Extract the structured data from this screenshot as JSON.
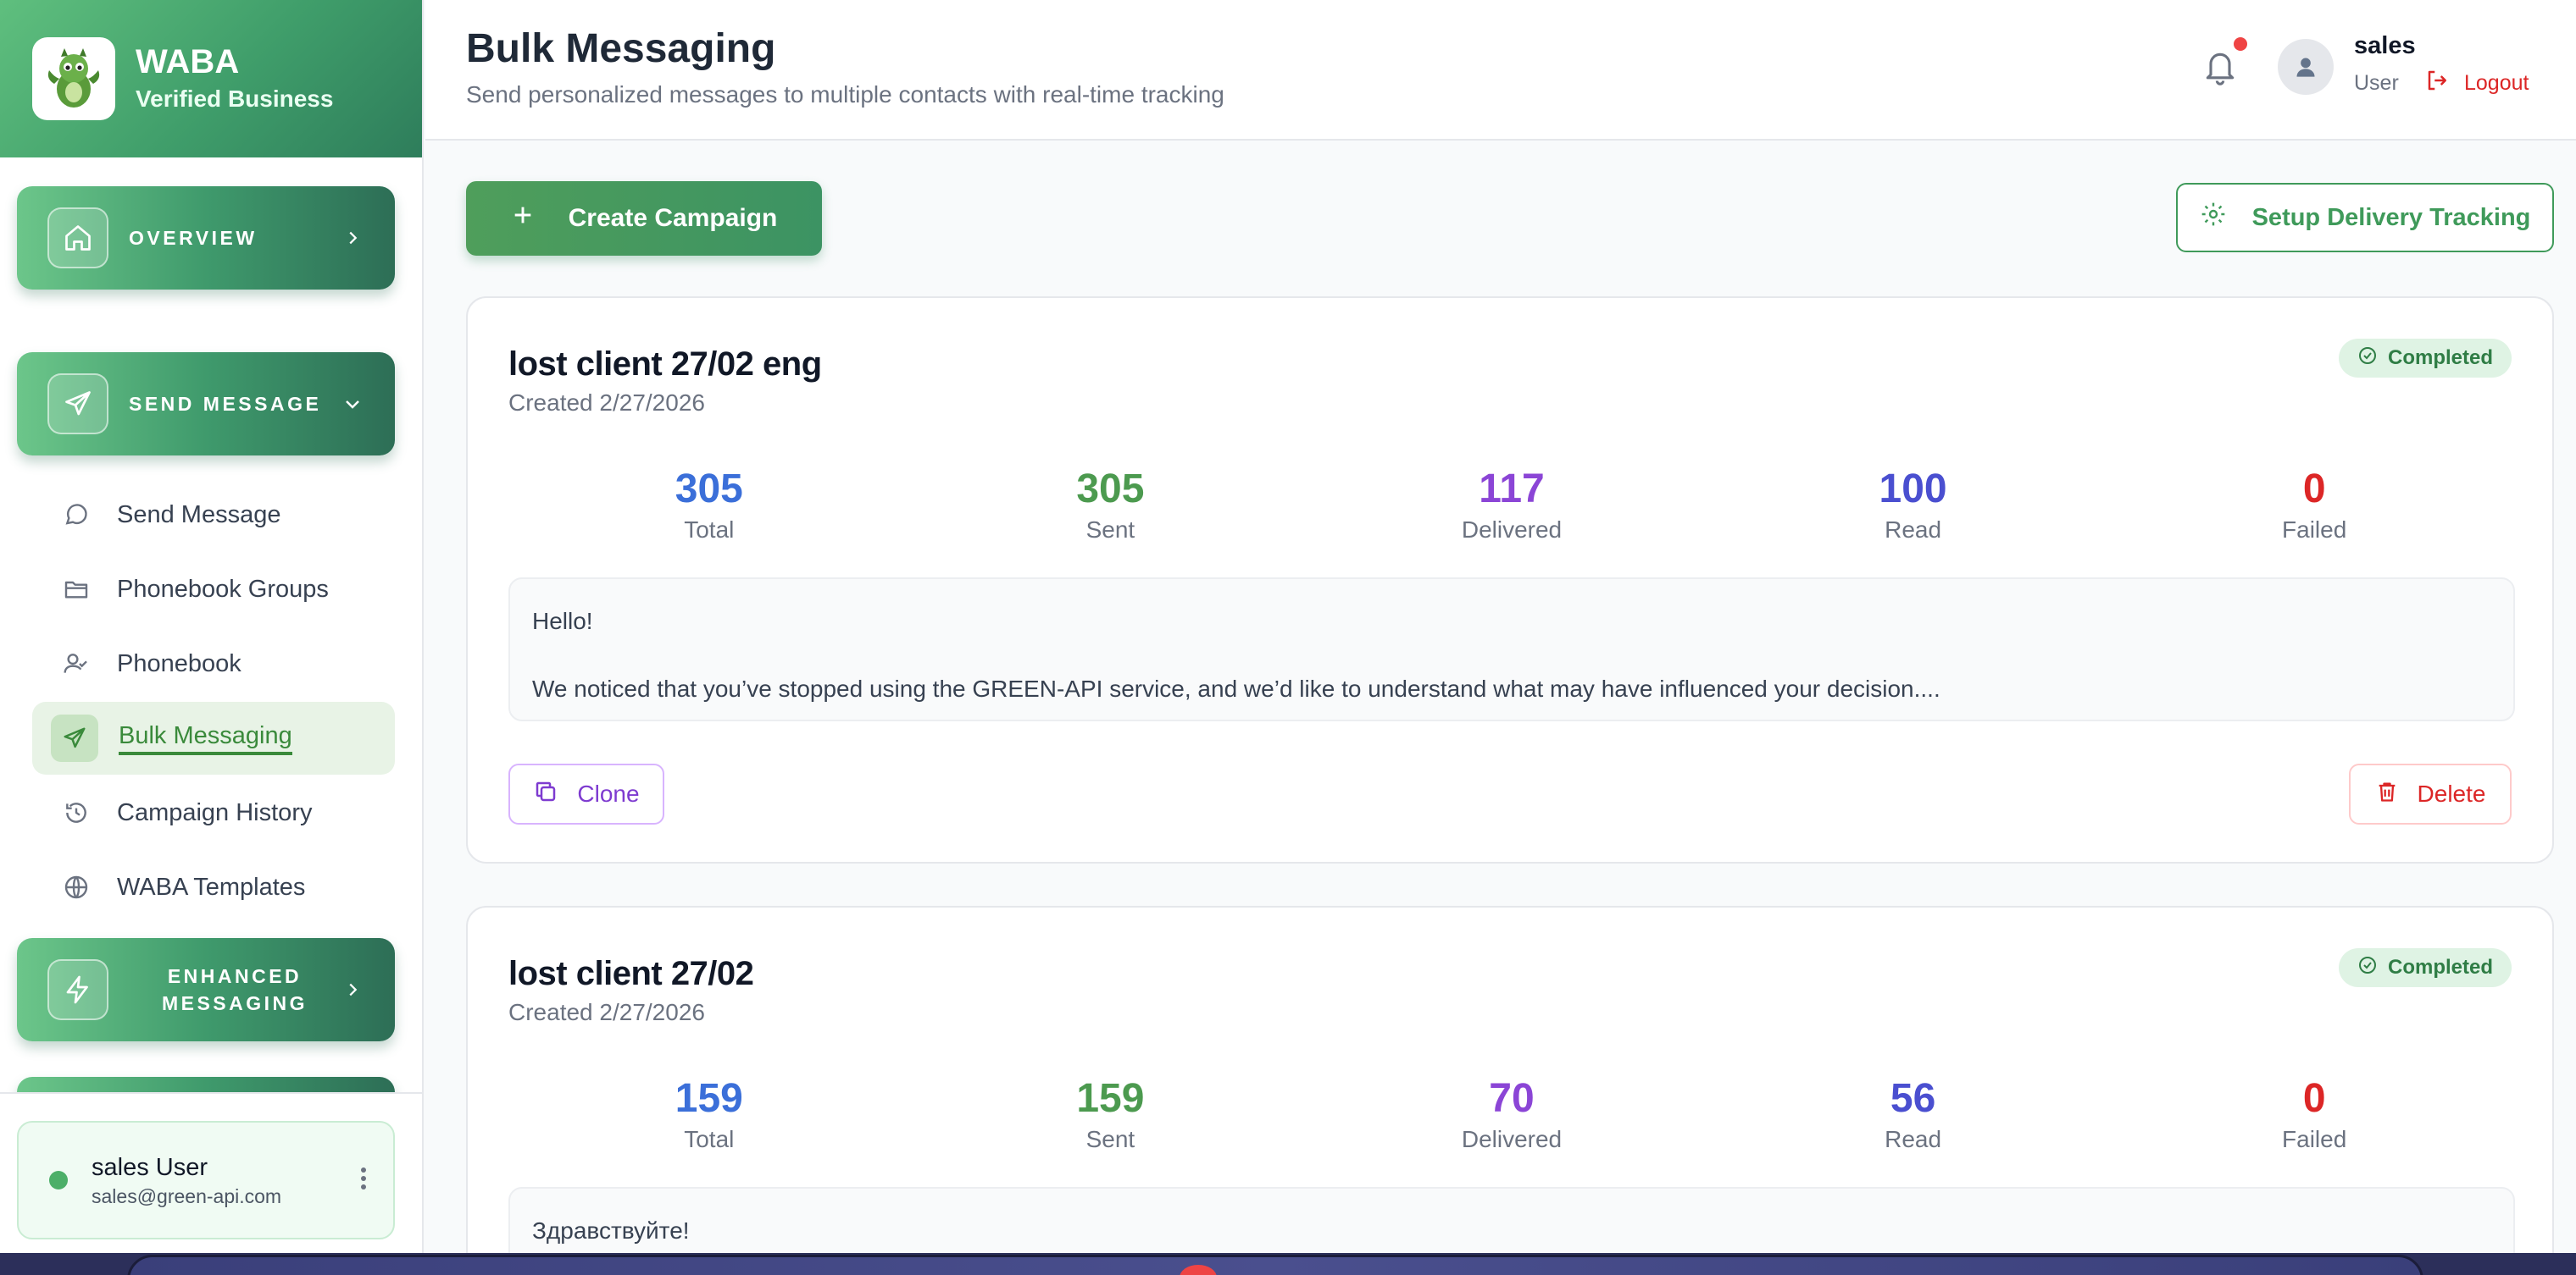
{
  "brand": {
    "title": "WABA",
    "subtitle": "Verified Business"
  },
  "sidebar": {
    "sections": [
      {
        "label": "OVERVIEW",
        "icon": "home-icon",
        "chevron": "chevron-right-icon"
      },
      {
        "label": "SEND MESSAGE",
        "icon": "send-icon",
        "chevron": "chevron-down-icon"
      },
      {
        "label": "ENHANCED MESSAGING",
        "icon": "bolt-icon",
        "chevron": "chevron-right-icon"
      }
    ],
    "items": [
      {
        "label": "Send Message",
        "icon": "chat-bubble-icon"
      },
      {
        "label": "Phonebook Groups",
        "icon": "folder-icon"
      },
      {
        "label": "Phonebook",
        "icon": "user-check-icon"
      },
      {
        "label": "Bulk Messaging",
        "icon": "send-icon",
        "active": true
      },
      {
        "label": "Campaign History",
        "icon": "history-icon"
      },
      {
        "label": "WABA Templates",
        "icon": "globe-icon"
      }
    ],
    "user": {
      "name": "sales User",
      "email": "sales@green-api.com",
      "status": "online"
    }
  },
  "header": {
    "title": "Bulk Messaging",
    "subtitle": "Send personalized messages to multiple contacts with real-time tracking",
    "user_name": "sales",
    "user_role": "User",
    "logout_label": "Logout"
  },
  "actions": {
    "create_label": "Create Campaign",
    "setup_label": "Setup Delivery Tracking"
  },
  "stat_labels": {
    "total": "Total",
    "sent": "Sent",
    "delivered": "Delivered",
    "read": "Read",
    "failed": "Failed"
  },
  "campaigns": [
    {
      "title": "lost client 27/02 eng",
      "created": "Created 2/27/2026",
      "status": "Completed",
      "total": "305",
      "sent": "305",
      "delivered": "117",
      "read": "100",
      "failed": "0",
      "message_line1": "Hello!",
      "message_line2": "We noticed that you’ve stopped using the GREEN-API service, and we’d like to understand what may have influenced your decision....",
      "clone_label": "Clone",
      "delete_label": "Delete"
    },
    {
      "title": "lost client 27/02",
      "created": "Created 2/27/2026",
      "status": "Completed",
      "total": "159",
      "sent": "159",
      "delivered": "70",
      "read": "56",
      "failed": "0",
      "message_line1": "Здравствуйте!"
    }
  ],
  "colors": {
    "brand_green": "#3f9d6a",
    "total": "#3b6fd9",
    "sent": "#4c9a4f",
    "delivered": "#8b45d6",
    "read": "#4a4fd0",
    "failed": "#dc2626"
  }
}
